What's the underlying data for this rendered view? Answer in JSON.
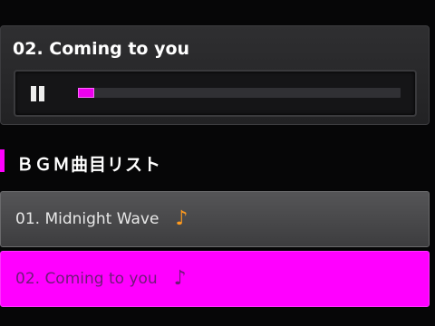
{
  "player": {
    "now_playing": "02. Coming to you",
    "pause_icon": "pause-icon",
    "progress": 0.05,
    "accent_color": "#ff00ff"
  },
  "playlist": {
    "title": "ＢＧＭ曲目リスト",
    "tracks": [
      {
        "label": "01. Midnight Wave",
        "icon": "music-note-icon",
        "note_glyph": "♪",
        "selected": false
      },
      {
        "label": "02. Coming to you",
        "icon": "music-note-icon",
        "note_glyph": "♪",
        "selected": true
      }
    ]
  }
}
